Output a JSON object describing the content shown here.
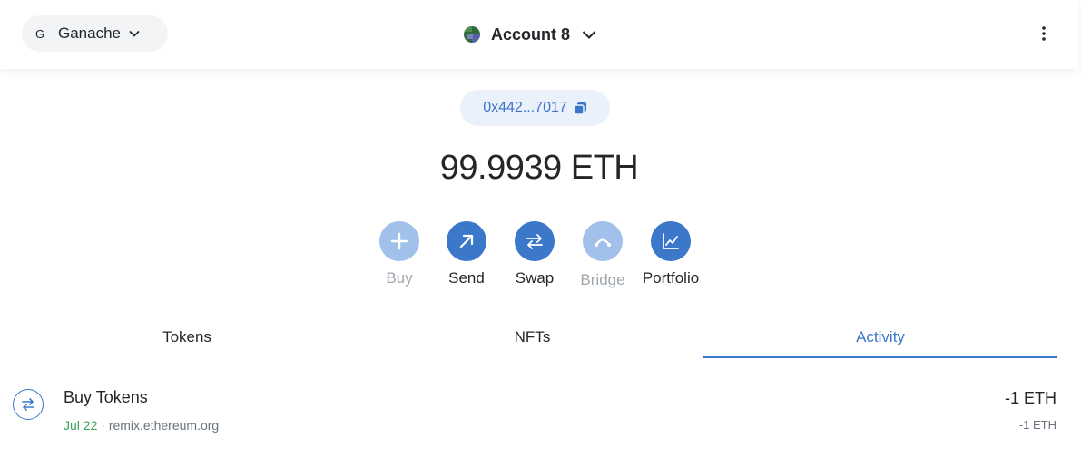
{
  "header": {
    "network": {
      "initial": "G",
      "name": "Ganache"
    },
    "account": {
      "name": "Account 8"
    }
  },
  "address": {
    "short": "0x442...7017"
  },
  "balance": {
    "amount": "99.9939",
    "unit": "ETH"
  },
  "actions": [
    {
      "label": "Buy",
      "icon": "plus-icon",
      "enabled": false
    },
    {
      "label": "Send",
      "icon": "arrow-up-right-icon",
      "enabled": true
    },
    {
      "label": "Swap",
      "icon": "swap-arrows-icon",
      "enabled": true
    },
    {
      "label": "Bridge",
      "icon": "bridge-icon",
      "enabled": false
    },
    {
      "label": "Portfolio",
      "icon": "chart-icon",
      "enabled": true
    }
  ],
  "tabs": [
    {
      "label": "Tokens",
      "active": false
    },
    {
      "label": "NFTs",
      "active": false
    },
    {
      "label": "Activity",
      "active": true
    }
  ],
  "activity": [
    {
      "title": "Buy Tokens",
      "date": "Jul 22",
      "separator": "·",
      "origin": "remix.ethereum.org",
      "amount": "-1 ETH",
      "fiat": "-1 ETH",
      "icon": "swap-arrows-icon"
    }
  ],
  "colors": {
    "accent": "#3b78c9",
    "accent_disabled": "#a2c1ea",
    "pill_bg": "#eaf1fa",
    "date_green": "#3ca05b"
  }
}
